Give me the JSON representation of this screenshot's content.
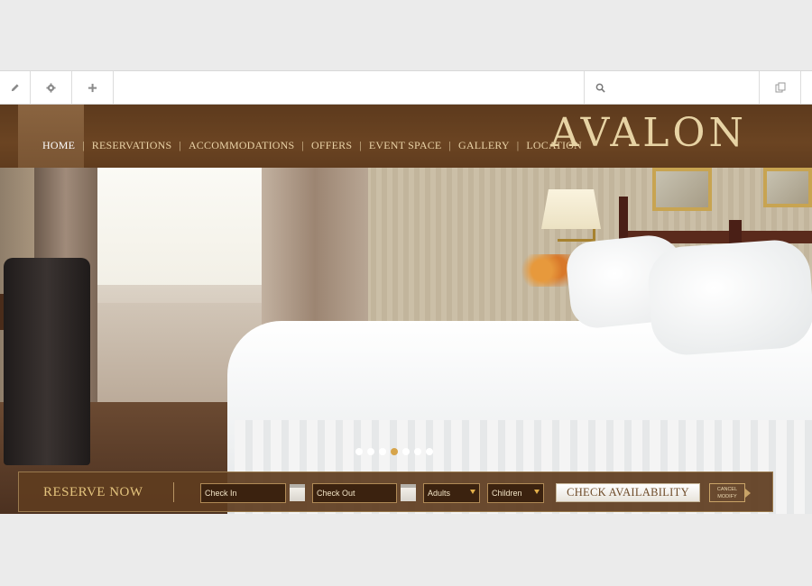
{
  "toolbar": {
    "edit_icon": "pencil-icon",
    "settings_icon": "gear-icon",
    "add_icon": "plus-icon",
    "search_icon": "search-icon",
    "copy_icon": "copy-icon"
  },
  "site": {
    "logo": "AVALON",
    "nav": [
      {
        "label": "HOME"
      },
      {
        "label": "RESERVATIONS"
      },
      {
        "label": "ACCOMMODATIONS"
      },
      {
        "label": "OFFERS"
      },
      {
        "label": "EVENT SPACE"
      },
      {
        "label": "GALLERY"
      },
      {
        "label": "LOCATION"
      }
    ],
    "nav_separator": "|",
    "active_nav": "HOME",
    "slider": {
      "total": 7,
      "active_index": 3
    },
    "reserve": {
      "title": "RESERVE NOW",
      "check_in_placeholder": "Check In",
      "check_out_placeholder": "Check Out",
      "adults_label": "Adults",
      "children_label": "Children",
      "check_button": "CHECK AVAILABILITY",
      "cancel_line1": "CANCEL",
      "cancel_line2": "MODIFY"
    }
  },
  "colors": {
    "header_brown": "#6b4422",
    "logo_gold": "#e7d3a4",
    "dot_active": "#d6a44a"
  }
}
